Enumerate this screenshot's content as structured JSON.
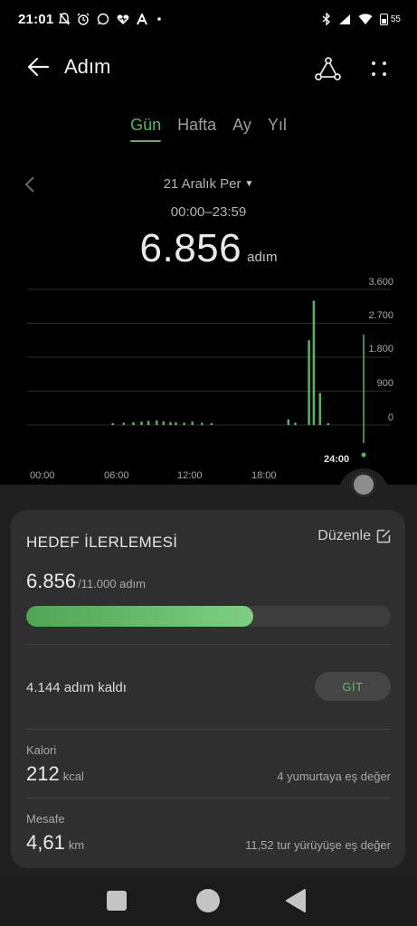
{
  "status_bar": {
    "time": "21:01",
    "battery": "55",
    "left_icons": [
      "do-not-disturb-icon",
      "alarm-icon",
      "whatsapp-icon",
      "heart-icon",
      "a-icon",
      "dot-icon"
    ],
    "right_icons": [
      "bluetooth-icon",
      "signal-icon",
      "wifi-icon",
      "battery-icon"
    ]
  },
  "app_bar": {
    "title": "Adım"
  },
  "tabs": [
    {
      "label": "Gün",
      "active": true
    },
    {
      "label": "Hafta",
      "active": false
    },
    {
      "label": "Ay",
      "active": false
    },
    {
      "label": "Yıl",
      "active": false
    }
  ],
  "date": {
    "label": "21 Aralık Per",
    "range": "00:00–23:59"
  },
  "total": {
    "value": "6.856",
    "unit": "adım"
  },
  "chart_data": {
    "type": "bar",
    "x_ticks": [
      "00:00",
      "06:00",
      "12:00",
      "18:00"
    ],
    "marker_label": "24:00",
    "y_ticks": [
      "3.600",
      "2.700",
      "1.800",
      "900",
      "0"
    ],
    "ylim": [
      0,
      3600
    ],
    "xlim_hours": [
      0,
      24
    ],
    "bars": [
      {
        "hour": 5.7,
        "value": 40
      },
      {
        "hour": 6.5,
        "value": 60
      },
      {
        "hour": 7.2,
        "value": 70
      },
      {
        "hour": 7.8,
        "value": 90
      },
      {
        "hour": 8.3,
        "value": 110
      },
      {
        "hour": 8.9,
        "value": 120
      },
      {
        "hour": 9.4,
        "value": 100
      },
      {
        "hour": 9.9,
        "value": 80
      },
      {
        "hour": 10.3,
        "value": 70
      },
      {
        "hour": 10.9,
        "value": 60
      },
      {
        "hour": 11.5,
        "value": 90
      },
      {
        "hour": 12.2,
        "value": 60
      },
      {
        "hour": 12.9,
        "value": 50
      },
      {
        "hour": 18.5,
        "value": 150
      },
      {
        "hour": 19.0,
        "value": 60
      },
      {
        "hour": 20.0,
        "value": 2250
      },
      {
        "hour": 20.35,
        "value": 3300
      },
      {
        "hour": 20.8,
        "value": 850
      },
      {
        "hour": 21.4,
        "value": 50
      }
    ],
    "colors": {
      "bar": "#58b360",
      "grid": "#2c2c2c",
      "marker": "#58b360"
    }
  },
  "goal_card": {
    "title": "HEDEF İLERLEMESİ",
    "edit_label": "Düzenle",
    "current": "6.856",
    "total": "/11.000 adım",
    "progress_fraction": 0.623,
    "remaining": "4.144 adım kaldı",
    "go_label": "GİT"
  },
  "stats": [
    {
      "label": "Kalori",
      "value": "212",
      "unit": "kcal",
      "note": "4 yumurtaya eş değer"
    },
    {
      "label": "Mesafe",
      "value": "4,61",
      "unit": "km",
      "note": "11,52 tur yürüyüşe eş değer"
    }
  ],
  "colors": {
    "accent": "#58b360",
    "background": "#000000",
    "sheet": "#202020",
    "card": "#2f2f2f"
  }
}
